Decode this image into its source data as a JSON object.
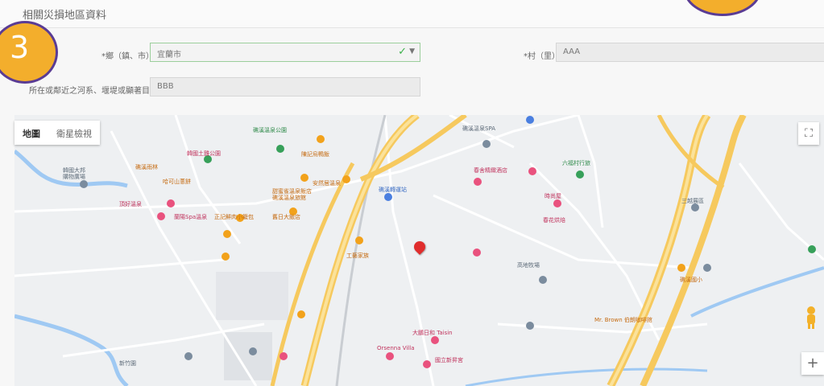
{
  "section": {
    "title": "相關災損地區資料"
  },
  "badges": {
    "step": "3"
  },
  "form": {
    "county_label": "*鄉（鎮、市）",
    "county_value": "宜蘭市",
    "village_label": "*村（里）",
    "village_value": "AAA",
    "river_label": "所在或鄰近之河系、堰堤或顯著目標",
    "river_value": "BBB"
  },
  "map": {
    "tabs": [
      "地圖",
      "衛星檢視"
    ],
    "fullscreen_icon": "fullscreen-icon",
    "zoom_in": "+",
    "pegman_icon": "pegman-icon",
    "marker_icon": "red-location-pin-icon",
    "pois": [
      "礁溪溫泉公園",
      "韓國大邦",
      "購物廣場",
      "礁溪雨林",
      "哈可山蔥餅",
      "韓國土雞公園",
      "陳記烏鴨飯",
      "安然居溫泉",
      "甜蜜雀溫泉飯店",
      "礁溪溫泉旅館",
      "頂好溫泉",
      "正記鮮肉小籠包",
      "舊日大飯店",
      "礁溪溫泉SPA",
      "春舍精緻酒店",
      "六福村行旅",
      "礁溪轉運站",
      "春花烘焙",
      "時尚屋",
      "工藝家族",
      "高地牧場",
      "大鵬日和 Taisin",
      "Orsenna Villa",
      "國立新昇宮",
      "Mr. Brown 伯朗咖啡館",
      "三越展區",
      "礁溪國小",
      "蘭陽Spa溫泉",
      "新竹園"
    ]
  }
}
